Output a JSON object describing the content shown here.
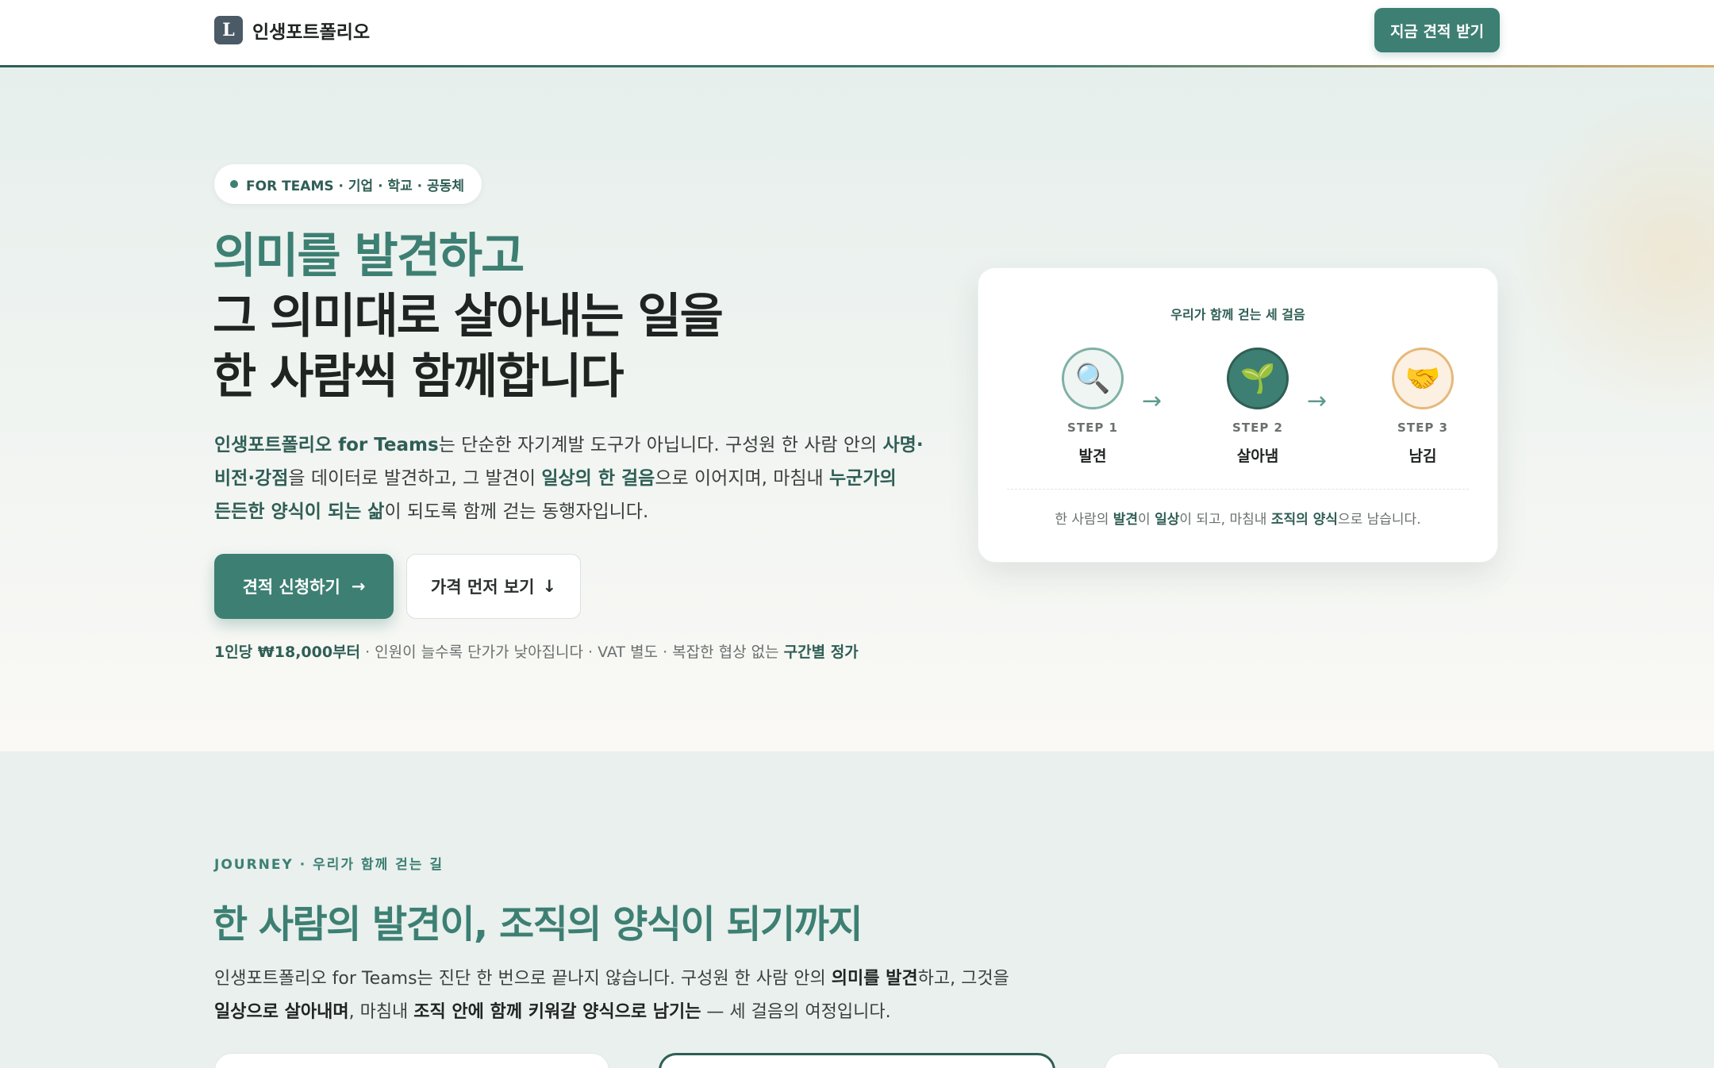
{
  "header": {
    "brand_logo_letter": "L",
    "brand_name": "인생포트폴리오",
    "cta_label": "지금 견적 받기"
  },
  "hero": {
    "pill_text": "FOR TEAMS · 기업 · 학교 · 공동체",
    "title_line1": "의미를 발견하고",
    "title_line2": "그 의미대로 살아내는 일을",
    "title_line3": "한 사람씩 함께합니다",
    "desc": {
      "l1_b1": "인생포트폴리오 for Teams",
      "l1_t1": "는 단순한 자기계발 도구가 아닙니다. 구성원 한 사람 안의 ",
      "l1_b2": "사명·",
      "l2_b1": "비전·강점",
      "l2_t1": "을 데이터로 발견하고, 그 발견이 ",
      "l2_b2": "일상의 한 걸음",
      "l2_t2": "으로 이어지며, 마침내 ",
      "l2_b3": "누군가의",
      "l3_b1": "든든한 양식이 되는 삶",
      "l3_t1": "이 되도록 함께 걷는 동행자입니다."
    },
    "primary_button": "견적 신청하기",
    "primary_button_icon": "→",
    "secondary_button": "가격 먼저 보기",
    "secondary_button_icon": "↓",
    "price_strong": "1인당 ₩18,000부터",
    "price_text": " · 인원이 늘수록 단가가 낮아집니다 · VAT 별도 · 복잡한 협상 없는 ",
    "price_strong2": "구간별 정가"
  },
  "steps_card": {
    "title": "우리가 함께 걷는 세 걸음",
    "steps": [
      {
        "icon": "🔍",
        "label": "STEP 1",
        "name": "발견"
      },
      {
        "icon": "🌱",
        "label": "STEP 2",
        "name": "살아냄"
      },
      {
        "icon": "🤝",
        "label": "STEP 3",
        "name": "남김"
      }
    ],
    "arrow": "→",
    "foot": {
      "t1": "한 사람의 ",
      "b1": "발견",
      "t2": "이 ",
      "b2": "일상",
      "t3": "이 되고, 마침내 ",
      "b3": "조직의 양식",
      "t4": "으로 남습니다."
    }
  },
  "journey": {
    "eyebrow": "JOURNEY · 우리가 함께 걷는 길",
    "title": "한 사람의 발견이, 조직의 양식이 되기까지",
    "d1_t1": "인생포트폴리오 for Teams는 진단 한 번으로 끝나지 않습니다. 구성원 한 사람 안의 ",
    "d1_b1": "의미를 발견",
    "d1_t2": "하고, 그것을",
    "d2_b1": "일상으로 살아내며",
    "d2_t1": ", 마침내 ",
    "d2_b2": "조직 안에 함께 키워갈 양식으로 남기는",
    "d2_t2": " — 세 걸음의 여정입니다."
  },
  "colors": {
    "accent": "#3d7f73",
    "accent_dark": "#2f5e55",
    "warm": "#e6b87a"
  }
}
